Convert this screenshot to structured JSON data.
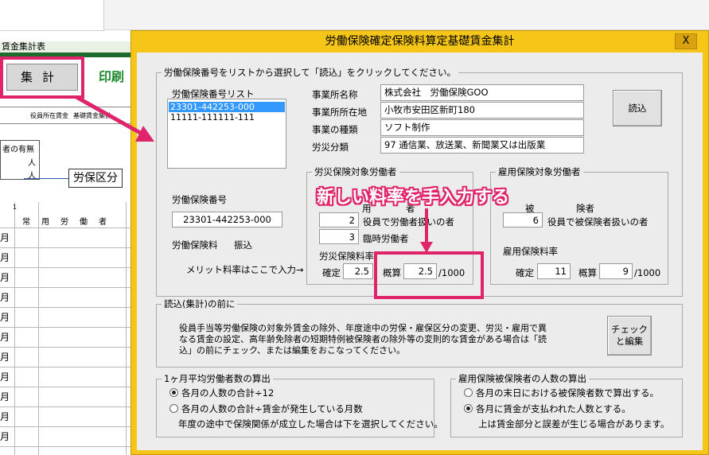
{
  "sheet": {
    "title": "賃金集計表",
    "shukei_button": "集計",
    "print_button": "印刷",
    "header_col1": "役員所在賃金",
    "header_col2": "基礎賃金集計",
    "box_line1": "者の有無",
    "box_line2": "人",
    "box_line3": "人",
    "roho_label": "労保区分",
    "col_number": "1",
    "col_jouyou": "常用労働者",
    "month": "月"
  },
  "dialog": {
    "title": "労働保険確定保険料算定基礎賃金集計",
    "close_label": "X",
    "top_group": {
      "legend": "労働保険番号をリストから選択して「読込」をクリックしてください。",
      "list_label": "労働保険番号リスト",
      "list_items": [
        "23301-442253-000",
        "11111-111111-111"
      ],
      "selected_index": 0,
      "office_name_label": "事業所名称",
      "office_name_value": "株式会社　労働保険GOO",
      "office_address_label": "事業所所在地",
      "office_address_value": "小牧市安田区新町180",
      "business_type_label": "事業の種類",
      "business_type_value": "ソフト制作",
      "accident_class_label": "労災分類",
      "accident_class_value": "97 通信業、放送業、新聞業又は出版業",
      "load_button": "読込",
      "insurance_number_label": "労働保険番号",
      "insurance_number_value": "23301-442253-000",
      "premium_label": "労働保険料",
      "premium_transfer": "振込",
      "merit_note": "メリット料率はここで入力→",
      "rousai_group": {
        "legend": "労災保険対象労働者",
        "row1_partial": "用",
        "row1_partial2": "者",
        "officer_value": "2",
        "officer_label": "役員で労働者扱いの者",
        "temp_value": "3",
        "temp_label": "臨時労働者",
        "rate_label": "労災保険料率",
        "confirmed_label": "確定",
        "confirmed_value": "2.5",
        "estimate_label": "概算",
        "estimate_value": "2.5",
        "per_mille": "/1000"
      },
      "koyou_group": {
        "legend": "雇用保険対象労働者",
        "row1_partial": "被",
        "row1_partial2": "険者",
        "officer_value": "6",
        "officer_label": "役員で被保険者扱いの者",
        "rate_label": "雇用保険料率",
        "confirmed_label": "確定",
        "confirmed_value": "11",
        "estimate_label": "概算",
        "estimate_value": "9",
        "per_mille": "/1000"
      }
    },
    "pre_load_group": {
      "legend": "読込(集計)の前に",
      "text_line1": "役員手当等労働保険の対象外賃金の除外、年度途中の労保・雇保区分の変更、労災・雇用で異",
      "text_line2": "なる賃金の設定、高年齢免除者の短期特例被保険者の除外等の変則的な賃金がある場合は「読",
      "text_line3": "込」の前にチェック、または編集をおこなってください。",
      "check_button_line1": "チェック",
      "check_button_line2": "と編集"
    },
    "avg_group": {
      "legend": "1ヶ月平均労働者数の算出",
      "option1": "各月の人数の合計÷12",
      "option2": "各月の人数の合計÷賃金が発生している月数",
      "note": "年度の途中で保険関係が成立した場合は下を選択してください。",
      "selected": 1
    },
    "insured_group": {
      "legend": "雇用保険被保険者の人数の算出",
      "option1": "各月の末日における被保険者数で算出する。",
      "option2": "各月に賃金が支払われた人数とする。",
      "note": "上は賃金部分と誤差が生じる場合があります。",
      "selected": 2
    }
  },
  "annotation": {
    "text": "新しい料率を手入力する",
    "color": "#e0246c"
  }
}
